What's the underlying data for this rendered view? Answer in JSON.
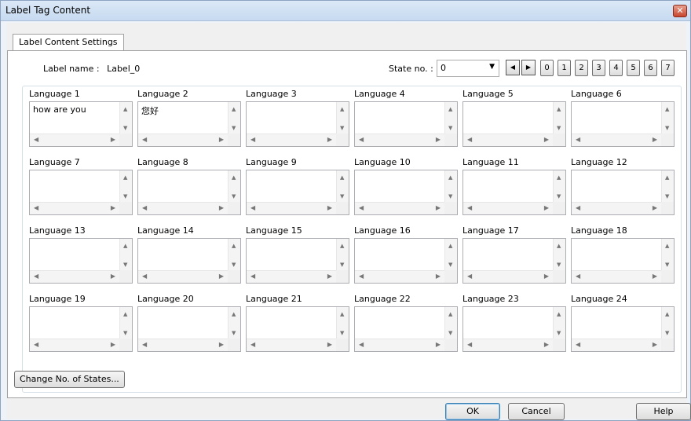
{
  "window": {
    "title": "Label Tag Content",
    "close_glyph": "✕"
  },
  "tab": {
    "label": "Label Content Settings"
  },
  "label_name": {
    "label": "Label name :",
    "value": "Label_0"
  },
  "state": {
    "label": "State no. :",
    "selected": "0",
    "prev_glyph": "◀",
    "next_glyph": "▶",
    "buttons": [
      "0",
      "1",
      "2",
      "3",
      "4",
      "5",
      "6",
      "7"
    ]
  },
  "languages": [
    {
      "label": "Language 1",
      "value": "how are you"
    },
    {
      "label": "Language 2",
      "value": "您好"
    },
    {
      "label": "Language 3",
      "value": ""
    },
    {
      "label": "Language 4",
      "value": ""
    },
    {
      "label": "Language 5",
      "value": ""
    },
    {
      "label": "Language 6",
      "value": ""
    },
    {
      "label": "Language 7",
      "value": ""
    },
    {
      "label": "Language 8",
      "value": ""
    },
    {
      "label": "Language 9",
      "value": ""
    },
    {
      "label": "Language 10",
      "value": ""
    },
    {
      "label": "Language 11",
      "value": ""
    },
    {
      "label": "Language 12",
      "value": ""
    },
    {
      "label": "Language 13",
      "value": ""
    },
    {
      "label": "Language 14",
      "value": ""
    },
    {
      "label": "Language 15",
      "value": ""
    },
    {
      "label": "Language 16",
      "value": ""
    },
    {
      "label": "Language 17",
      "value": ""
    },
    {
      "label": "Language 18",
      "value": ""
    },
    {
      "label": "Language 19",
      "value": ""
    },
    {
      "label": "Language 20",
      "value": ""
    },
    {
      "label": "Language 21",
      "value": ""
    },
    {
      "label": "Language 22",
      "value": ""
    },
    {
      "label": "Language 23",
      "value": ""
    },
    {
      "label": "Language 24",
      "value": ""
    }
  ],
  "buttons": {
    "change_states": "Change No. of States...",
    "ok": "OK",
    "cancel": "Cancel",
    "help": "Help"
  }
}
